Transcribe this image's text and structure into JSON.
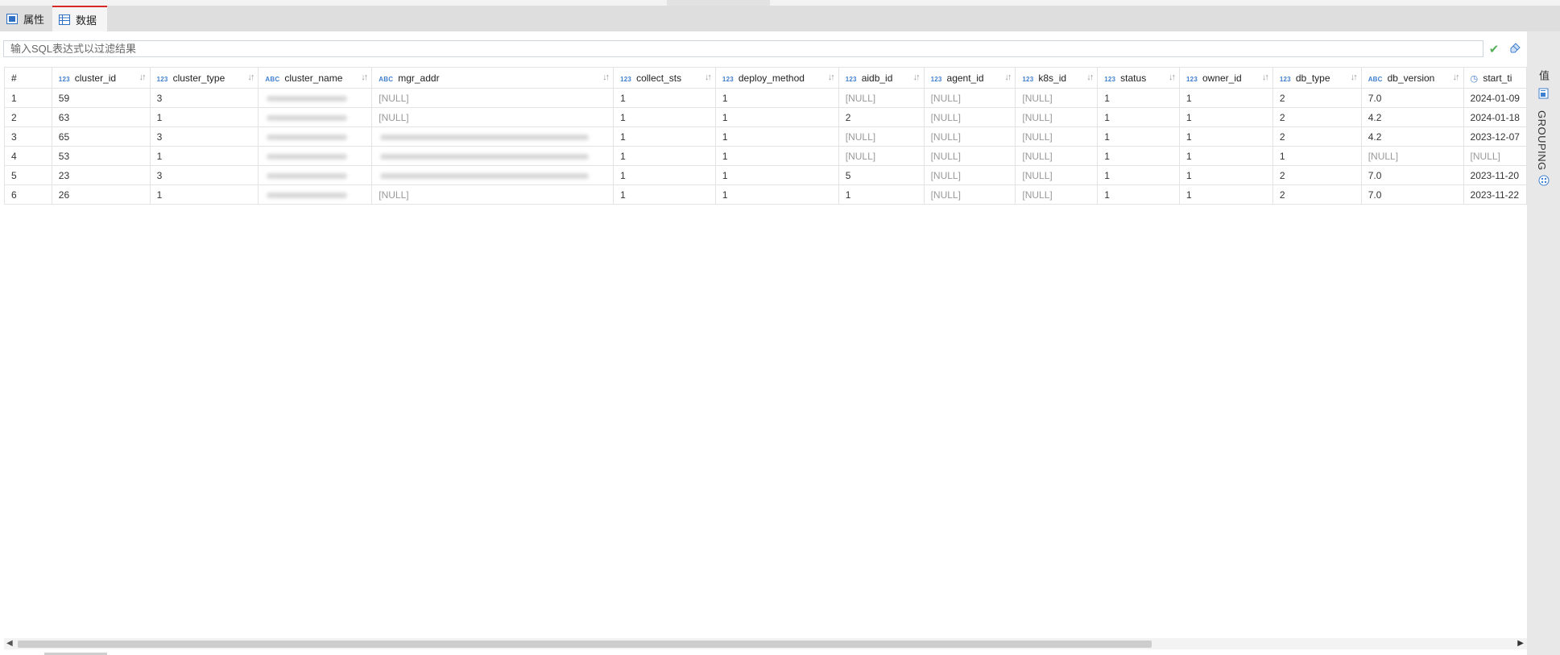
{
  "tabs": [
    {
      "label": "属性",
      "icon": "properties-icon",
      "active": false
    },
    {
      "label": "数据",
      "icon": "table-data-icon",
      "active": true
    }
  ],
  "filter": {
    "placeholder": "输入SQL表达式以过滤结果",
    "apply_icon": "check-icon",
    "clear_icon": "eraser-icon"
  },
  "grid": {
    "row_number_header": "#",
    "columns": [
      {
        "name": "cluster_id",
        "type": "123"
      },
      {
        "name": "cluster_type",
        "type": "123"
      },
      {
        "name": "cluster_name",
        "type": "ABC"
      },
      {
        "name": "mgr_addr",
        "type": "ABC"
      },
      {
        "name": "collect_sts",
        "type": "123"
      },
      {
        "name": "deploy_method",
        "type": "123"
      },
      {
        "name": "aidb_id",
        "type": "123"
      },
      {
        "name": "agent_id",
        "type": "123"
      },
      {
        "name": "k8s_id",
        "type": "123"
      },
      {
        "name": "status",
        "type": "123"
      },
      {
        "name": "owner_id",
        "type": "123"
      },
      {
        "name": "db_type",
        "type": "123"
      },
      {
        "name": "db_version",
        "type": "ABC"
      },
      {
        "name": "start_ti",
        "type": "clock"
      }
    ],
    "rows": [
      [
        "1",
        "59",
        "3",
        "",
        "[NULL]",
        "1",
        "1",
        "[NULL]",
        "[NULL]",
        "[NULL]",
        "1",
        "1",
        "2",
        "7.0",
        "2024-01-09"
      ],
      [
        "2",
        "63",
        "1",
        "",
        "[NULL]",
        "1",
        "1",
        "2",
        "[NULL]",
        "[NULL]",
        "1",
        "1",
        "2",
        "4.2",
        "2024-01-18"
      ],
      [
        "3",
        "65",
        "3",
        "",
        "",
        "1",
        "1",
        "[NULL]",
        "[NULL]",
        "[NULL]",
        "1",
        "1",
        "2",
        "4.2",
        "2023-12-07"
      ],
      [
        "4",
        "53",
        "1",
        "",
        "",
        "1",
        "1",
        "[NULL]",
        "[NULL]",
        "[NULL]",
        "1",
        "1",
        "1",
        "[NULL]",
        "[NULL]"
      ],
      [
        "5",
        "23",
        "3",
        "",
        "",
        "1",
        "1",
        "5",
        "[NULL]",
        "[NULL]",
        "1",
        "1",
        "2",
        "7.0",
        "2023-11-20"
      ],
      [
        "6",
        "26",
        "1",
        "",
        "[NULL]",
        "1",
        "1",
        "1",
        "[NULL]",
        "[NULL]",
        "1",
        "1",
        "2",
        "7.0",
        "2023-11-22"
      ]
    ]
  },
  "side_panel": {
    "value_label": "值",
    "grouping_label": "GROUPING",
    "icons": [
      "value-panel-icon",
      "doc-icon",
      "grouping-icon"
    ]
  }
}
